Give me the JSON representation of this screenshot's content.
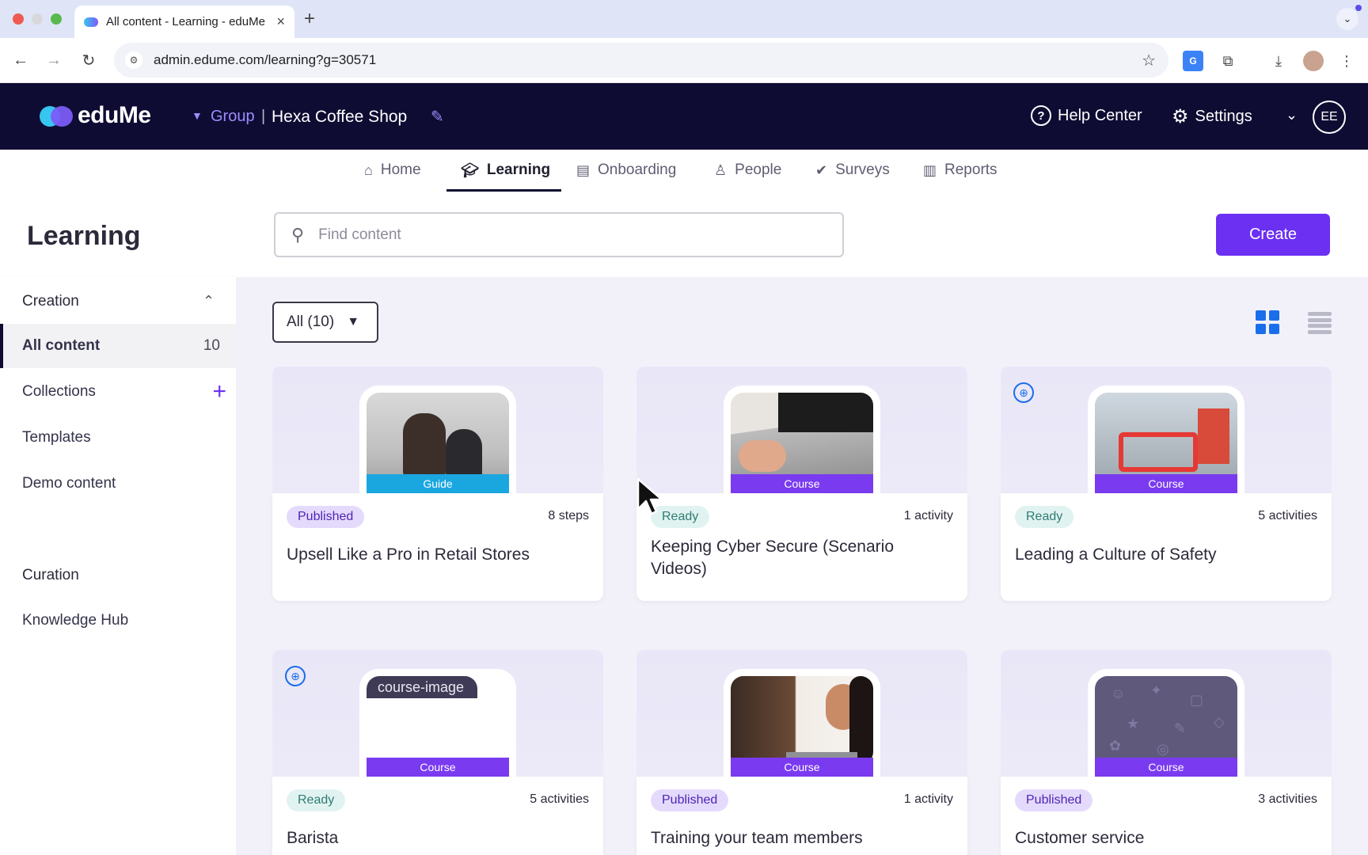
{
  "browser": {
    "tab_title": "All content - Learning - eduMe",
    "tab_close": "×",
    "new_tab": "+",
    "url": "admin.edume.com/learning?g=30571"
  },
  "header": {
    "logo_text": "eduMe",
    "group_label": "Group",
    "group_separator": "|",
    "group_name": "Hexa Coffee Shop",
    "help_label": "Help Center",
    "settings_label": "Settings",
    "avatar_initials": "EE"
  },
  "nav": {
    "items": [
      {
        "label": "Home",
        "icon": "home-icon"
      },
      {
        "label": "Learning",
        "icon": "graduation-icon",
        "active": true
      },
      {
        "label": "Onboarding",
        "icon": "inbox-icon"
      },
      {
        "label": "People",
        "icon": "person-icon"
      },
      {
        "label": "Surveys",
        "icon": "check-icon"
      },
      {
        "label": "Reports",
        "icon": "bar-chart-icon"
      }
    ]
  },
  "page": {
    "title": "Learning",
    "search_placeholder": "Find content",
    "create_label": "Create"
  },
  "sidebar": {
    "creation_heading": "Creation",
    "items": [
      {
        "label": "All content",
        "count": "10"
      },
      {
        "label": "Collections"
      },
      {
        "label": "Templates"
      },
      {
        "label": "Demo content"
      }
    ],
    "curation_heading": "Curation",
    "curation_items": [
      {
        "label": "Knowledge Hub"
      }
    ]
  },
  "content": {
    "filter_label": "All (10)",
    "cards": [
      {
        "type": "Guide",
        "status": "Published",
        "meta": "8 steps",
        "title": "Upsell Like a Pro in Retail Stores"
      },
      {
        "type": "Course",
        "status": "Ready",
        "meta": "1 activity",
        "title": "Keeping Cyber Secure (Scenario Videos)"
      },
      {
        "type": "Course",
        "status": "Ready",
        "meta": "5 activities",
        "title": "Leading a Culture of Safety",
        "globe": true
      },
      {
        "type": "Course",
        "status": "Ready",
        "meta": "5 activities",
        "title": "Barista",
        "globe": true,
        "image_alt": "course-image"
      },
      {
        "type": "Course",
        "status": "Published",
        "meta": "1 activity",
        "title": "Training your team members"
      },
      {
        "type": "Course",
        "status": "Published",
        "meta": "3 activities",
        "title": "Customer service"
      }
    ]
  },
  "colors": {
    "header_bg": "#0f0c33",
    "accent": "#6b30f2",
    "content_bg": "#f2f1fa"
  }
}
